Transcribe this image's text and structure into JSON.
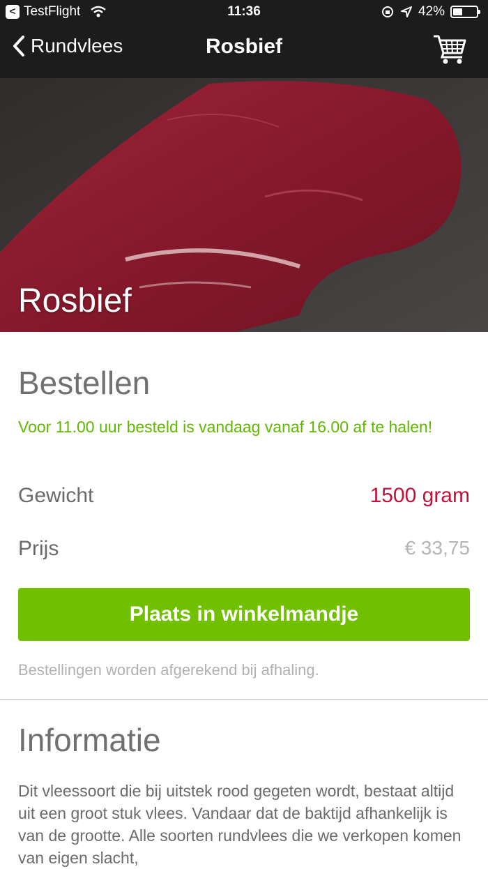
{
  "status_bar": {
    "carrier": "TestFlight",
    "time": "11:36",
    "battery": "42%",
    "battery_level": 0.42
  },
  "nav": {
    "back_label": "Rundvlees",
    "title": "Rosbief",
    "cart_icon": "cart-icon"
  },
  "hero": {
    "title": "Rosbief"
  },
  "order": {
    "heading": "Bestellen",
    "notice": "Voor 11.00 uur besteld is vandaag vanaf 16.00 af te halen!",
    "weight_label": "Gewicht",
    "weight_value": "1500 gram",
    "price_label": "Prijs",
    "price_value": "€ 33,75",
    "button_label": "Plaats in winkelmandje",
    "footnote": "Bestellingen worden afgerekend bij afhaling."
  },
  "info": {
    "heading": "Informatie",
    "text": "Dit vleessoort die bij uitstek rood gegeten wordt, bestaat altijd uit een groot stuk vlees. Vandaar dat de baktijd afhankelijk is van de grootte. Alle soorten rundvlees die we verkopen komen van eigen slacht,"
  },
  "colors": {
    "nav_bg": "#1c1c1c",
    "accent_green": "#70c000",
    "notice_green": "#61b800",
    "weight_red": "#c0113c"
  }
}
